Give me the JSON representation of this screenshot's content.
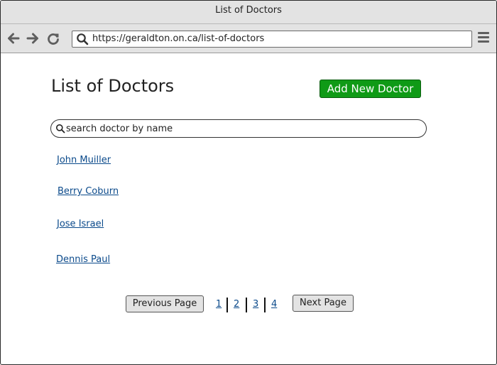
{
  "window": {
    "title": "List of Doctors"
  },
  "browser": {
    "url": "https://geraldton.on.ca/list-of-doctors",
    "icons": [
      "back-arrow-icon",
      "forward-arrow-icon",
      "reload-icon",
      "search-icon",
      "hamburger-menu-icon"
    ]
  },
  "page": {
    "heading": "List of Doctors",
    "add_button_label": "Add New Doctor",
    "search": {
      "placeholder": "search doctor by name",
      "value": ""
    },
    "doctors": [
      "John Muiller",
      "Berry Coburn",
      "Jose Israel",
      "Dennis Paul"
    ],
    "pagination": {
      "previous_label": "Previous Page",
      "next_label": "Next Page",
      "pages": [
        "1",
        "2",
        "3",
        "4"
      ]
    }
  },
  "colors": {
    "accent_green": "#0f9a16",
    "link_blue": "#0b4a8b",
    "chrome_gray": "#e3e3e3"
  }
}
